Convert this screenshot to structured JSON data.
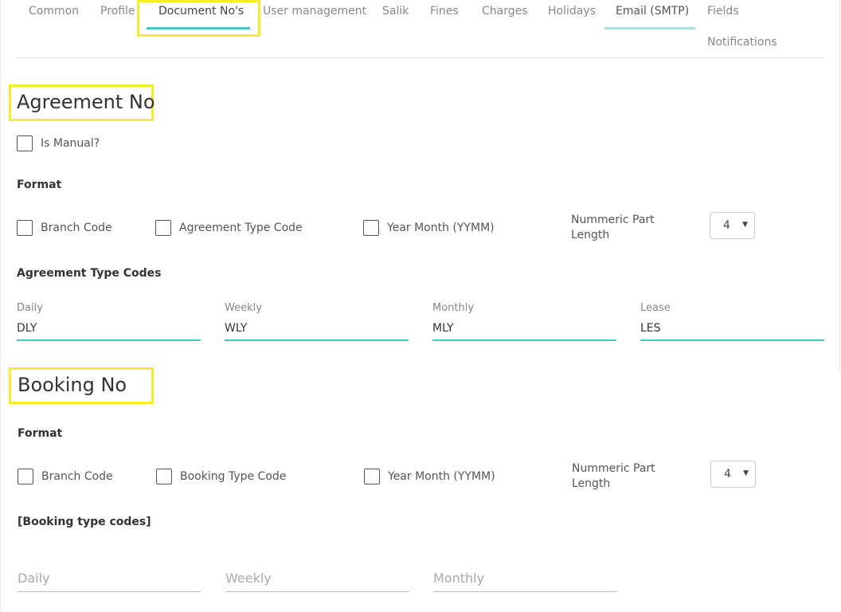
{
  "tabs": {
    "items": [
      {
        "label": "Common"
      },
      {
        "label": "Profile"
      },
      {
        "label": "Document No's"
      },
      {
        "label": "User management"
      },
      {
        "label": "Salik"
      },
      {
        "label": "Fines"
      },
      {
        "label": "Charges"
      },
      {
        "label": "Holidays"
      },
      {
        "label": "Email (SMTP)"
      },
      {
        "label": "Fields"
      },
      {
        "label": "Notifications"
      }
    ],
    "active": "Document No's"
  },
  "agreement": {
    "title": "Agreement No",
    "is_manual_label": "Is Manual?",
    "format_heading": "Format",
    "format_options": [
      {
        "label": "Branch Code",
        "checked": false
      },
      {
        "label": "Agreement Type Code",
        "checked": false
      },
      {
        "label": "Year Month (YYMM)",
        "checked": false
      }
    ],
    "numeric_part_label": "Nummeric Part Length",
    "numeric_part_value": "4",
    "type_codes_heading": "Agreement Type Codes",
    "type_codes": [
      {
        "label": "Daily",
        "value": "DLY"
      },
      {
        "label": "Weekly",
        "value": "WLY"
      },
      {
        "label": "Monthly",
        "value": "MLY"
      },
      {
        "label": "Lease",
        "value": "LES"
      }
    ]
  },
  "booking": {
    "title": "Booking No",
    "format_heading": "Format",
    "format_options": [
      {
        "label": "Branch Code",
        "checked": false
      },
      {
        "label": "Booking Type Code",
        "checked": false
      },
      {
        "label": "Year Month (YYMM)",
        "checked": false
      }
    ],
    "numeric_part_label": "Nummeric Part Length",
    "numeric_part_value": "4",
    "type_codes_heading": "[Booking type codes]",
    "type_codes": [
      {
        "placeholder": "Daily"
      },
      {
        "placeholder": "Weekly"
      },
      {
        "placeholder": "Monthly"
      }
    ]
  },
  "colors": {
    "accent": "#4fc3cc",
    "highlight": "#f5ee2e"
  }
}
